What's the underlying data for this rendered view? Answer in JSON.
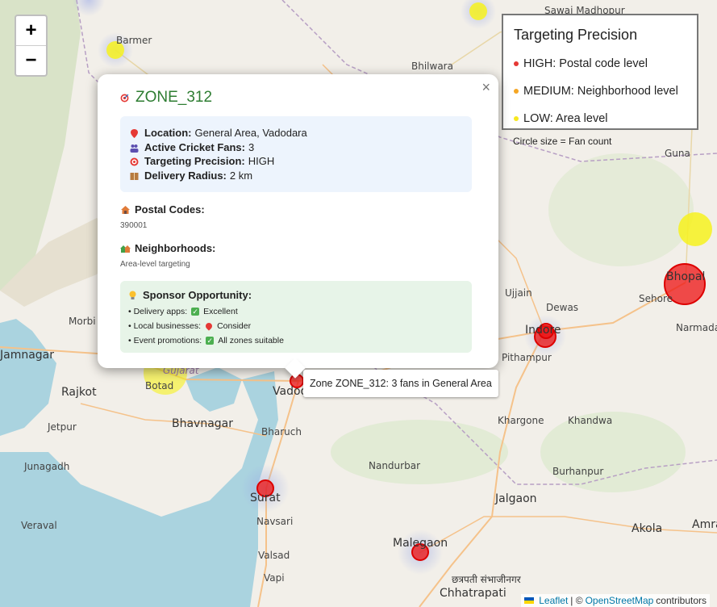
{
  "map": {
    "places": [
      {
        "name": "Barmer",
        "kind": "town"
      },
      {
        "name": "Bhilwara",
        "kind": "town"
      },
      {
        "name": "Sawai Madhopur",
        "kind": "town"
      },
      {
        "name": "Guna",
        "kind": "town"
      },
      {
        "name": "Bhopal",
        "kind": "city"
      },
      {
        "name": "Sehore",
        "kind": "town"
      },
      {
        "name": "Narmadapuram",
        "kind": "town"
      },
      {
        "name": "Ujjain",
        "kind": "town"
      },
      {
        "name": "Dewas",
        "kind": "town"
      },
      {
        "name": "Indore",
        "kind": "city"
      },
      {
        "name": "Pithampur",
        "kind": "town"
      },
      {
        "name": "Morbi",
        "kind": "town"
      },
      {
        "name": "Jamnagar",
        "kind": "city"
      },
      {
        "name": "Rajkot",
        "kind": "city"
      },
      {
        "name": "Botad",
        "kind": "town"
      },
      {
        "name": "Gujarat",
        "kind": "town"
      },
      {
        "name": "Vadodara",
        "kind": "city"
      },
      {
        "name": "Bhavnagar",
        "kind": "city"
      },
      {
        "name": "Jetpur",
        "kind": "town"
      },
      {
        "name": "Bharuch",
        "kind": "town"
      },
      {
        "name": "Khargone",
        "kind": "town"
      },
      {
        "name": "Khandwa",
        "kind": "town"
      },
      {
        "name": "Junagadh",
        "kind": "town"
      },
      {
        "name": "Nandurbar",
        "kind": "town"
      },
      {
        "name": "Burhanpur",
        "kind": "town"
      },
      {
        "name": "Surat",
        "kind": "city"
      },
      {
        "name": "Navsari",
        "kind": "town"
      },
      {
        "name": "Jalgaon",
        "kind": "city"
      },
      {
        "name": "Veraval",
        "kind": "town"
      },
      {
        "name": "Akola",
        "kind": "city"
      },
      {
        "name": "Amravati",
        "kind": "city"
      },
      {
        "name": "Valsad",
        "kind": "town"
      },
      {
        "name": "Malegaon",
        "kind": "city"
      },
      {
        "name": "Vapi",
        "kind": "town"
      },
      {
        "name": "छत्रपती संभाजीनगर",
        "kind": "dev"
      },
      {
        "name": "Chhatrapati",
        "kind": "city"
      }
    ]
  },
  "zoom": {
    "in_label": "+",
    "out_label": "−"
  },
  "legend": {
    "title": "Targeting Precision",
    "items": [
      {
        "label": "HIGH: Postal code level",
        "color": "#e53935"
      },
      {
        "label": "MEDIUM: Neighborhood level",
        "color": "#f5a623"
      },
      {
        "label": "LOW: Area level",
        "color": "#f7e81e"
      }
    ],
    "note": "Circle size = Fan count"
  },
  "popup": {
    "close": "×",
    "title": "ZONE_312",
    "info": [
      {
        "key": "Location:",
        "value": "General Area, Vadodara",
        "icon": "pin-icon"
      },
      {
        "key": "Active Cricket Fans:",
        "value": "3",
        "icon": "users-icon"
      },
      {
        "key": "Targeting Precision:",
        "value": "HIGH",
        "icon": "target-icon"
      },
      {
        "key": "Delivery Radius:",
        "value": "2 km",
        "icon": "package-icon"
      }
    ],
    "postal": {
      "title": "Postal Codes:",
      "value": "390001",
      "icon": "house-icon"
    },
    "neighborhoods": {
      "title": "Neighborhoods:",
      "value": "Area-level targeting",
      "icon": "houses-icon"
    },
    "sponsor": {
      "title": "Sponsor Opportunity:",
      "icon": "bulb-icon",
      "rows": [
        {
          "label": "• Delivery apps:",
          "value": "Excellent",
          "mark": "check"
        },
        {
          "label": "• Local businesses:",
          "value": "Consider",
          "mark": "pin"
        },
        {
          "label": "• Event promotions:",
          "value": "All zones suitable",
          "mark": "check"
        }
      ]
    }
  },
  "tooltip": "Zone ZONE_312: 3 fans in General Area",
  "attribution": {
    "leaflet": "Leaflet",
    "sep": "| ©",
    "osm": "OpenStreetMap",
    "suffix": "contributors"
  }
}
